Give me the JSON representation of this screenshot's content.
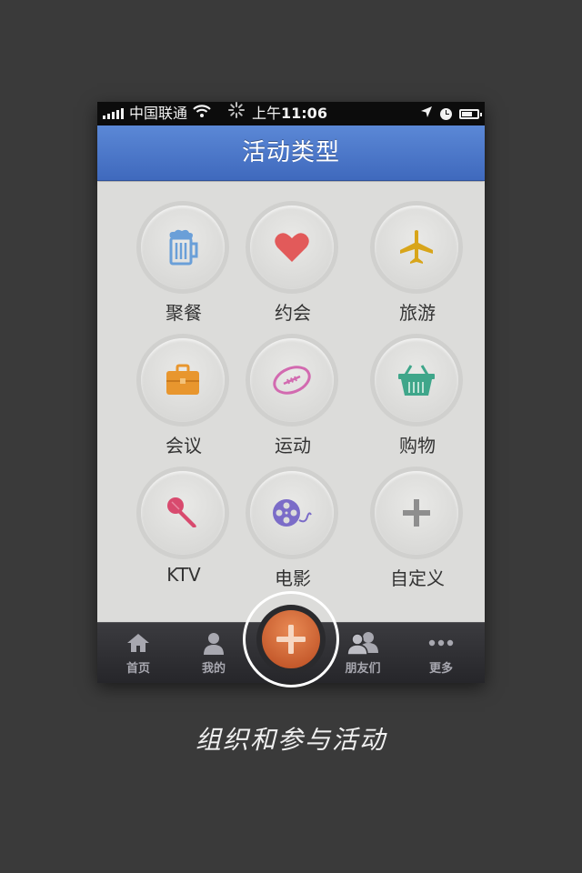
{
  "status_bar": {
    "carrier": "中国联通",
    "time_prefix": "上午",
    "time": "11:06"
  },
  "header": {
    "title": "活动类型"
  },
  "activity_types": [
    {
      "label": "聚餐",
      "icon": "beer-mug-icon",
      "color": "#6a9fd8"
    },
    {
      "label": "约会",
      "icon": "heart-icon",
      "color": "#e25a5a"
    },
    {
      "label": "旅游",
      "icon": "airplane-icon",
      "color": "#d8a51a"
    },
    {
      "label": "会议",
      "icon": "briefcase-icon",
      "color": "#e8962e"
    },
    {
      "label": "运动",
      "icon": "football-icon",
      "color": "#d26ab0"
    },
    {
      "label": "购物",
      "icon": "shopping-basket-icon",
      "color": "#3fa68a"
    },
    {
      "label": "KTV",
      "icon": "microphone-icon",
      "color": "#d84a6e"
    },
    {
      "label": "电影",
      "icon": "film-reel-icon",
      "color": "#7b6cc8"
    },
    {
      "label": "自定义",
      "icon": "plus-icon",
      "color": "#8e8e8e"
    }
  ],
  "tab_bar": {
    "items": [
      {
        "label": "首页",
        "icon": "home-icon"
      },
      {
        "label": "我的",
        "icon": "person-icon"
      },
      {
        "label": "朋友们",
        "icon": "friends-icon"
      },
      {
        "label": "更多",
        "icon": "more-dots-icon"
      }
    ],
    "center_button_icon": "add-icon",
    "center_button_color": "#d96a35"
  },
  "caption": "组织和参与活动"
}
